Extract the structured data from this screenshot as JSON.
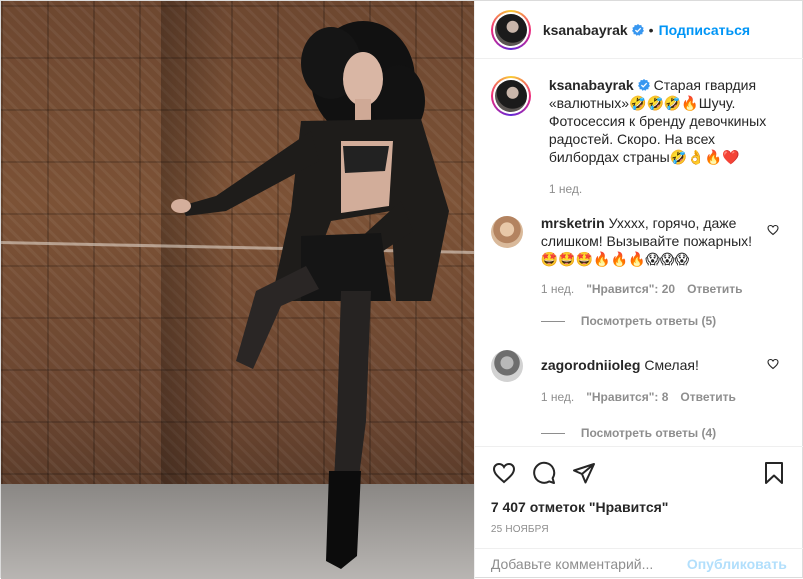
{
  "author": {
    "username": "ksanabayrak",
    "verified_icon": "verified-badge-icon",
    "follow_label": "Подписаться",
    "separator": "•"
  },
  "caption": {
    "username": "ksanabayrak",
    "text": "Старая гвардия «валютных»🤣🤣🤣🔥Шучу. Фотосессия к бренду девочкиных радостей. Скоро. На всех билбордах страны🤣👌🔥❤️",
    "time": "1 нед."
  },
  "comments": [
    {
      "username": "mrsketrin",
      "text": "Ухххх, горячо, даже слишком! Вызывайте пожарных! 🤩🤩🤩🔥🔥🔥😱😱😱",
      "time": "1 нед.",
      "likes": "\"Нравится\": 20",
      "reply_label": "Ответить",
      "view_replies": "Посмотреть ответы (5)"
    },
    {
      "username": "zagorodniioleg",
      "text": "Смелая!",
      "time": "1 нед.",
      "likes": "\"Нравится\": 8",
      "reply_label": "Ответить",
      "view_replies": "Посмотреть ответы (4)"
    }
  ],
  "actions": {
    "like_icon": "heart-icon",
    "comment_icon": "comment-icon",
    "share_icon": "share-icon",
    "save_icon": "bookmark-icon"
  },
  "likes_count": "7 407 отметок \"Нравится\"",
  "date": "25 НОЯБРЯ",
  "add_comment": {
    "placeholder": "Добавьте комментарий...",
    "publish_label": "Опубликовать"
  },
  "colors": {
    "accent": "#0095f6",
    "publish_disabled": "#b2dffc",
    "muted": "#8e8e8e",
    "text": "#262626"
  }
}
